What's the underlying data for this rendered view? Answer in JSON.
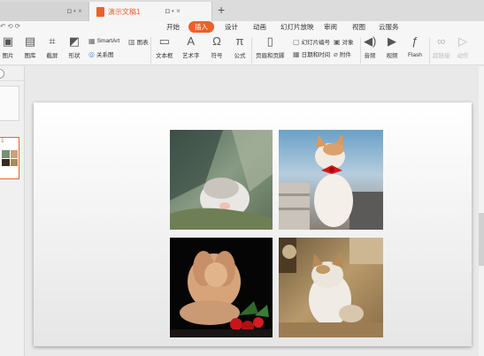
{
  "tabs": {
    "inactive_controls": "◘ • ×",
    "active_title": "演示文稿1",
    "active_controls": "◘ • ×",
    "plus": "+"
  },
  "menu": {
    "items": [
      "开始",
      "插入",
      "设计",
      "动画",
      "幻灯片放映",
      "审阅",
      "视图",
      "云服务"
    ],
    "active": "插入"
  },
  "toolbar": {
    "picture": "图片",
    "library": "图库",
    "screenshot": "截屏",
    "shape": "形状",
    "smartart": "SmartArt",
    "chart": "图表",
    "relation": "关系图",
    "textbox": "文本框",
    "wordart": "艺术字",
    "symbol": "符号",
    "formula": "公式",
    "header_footer": "页眉和页脚",
    "slide_number": "幻灯片编号",
    "object": "对象",
    "datetime": "日期和时间",
    "attachment": "附件",
    "audio": "音频",
    "video": "视频",
    "flash": "Flash",
    "hyperlink": "超链接",
    "action": "动作"
  },
  "slide_panel": {
    "slide_number": "1"
  },
  "colors": {
    "accent": "#e8622b",
    "ribbon_bg": "#f6f6f6",
    "canvas_bg": "#e9e9e9"
  }
}
